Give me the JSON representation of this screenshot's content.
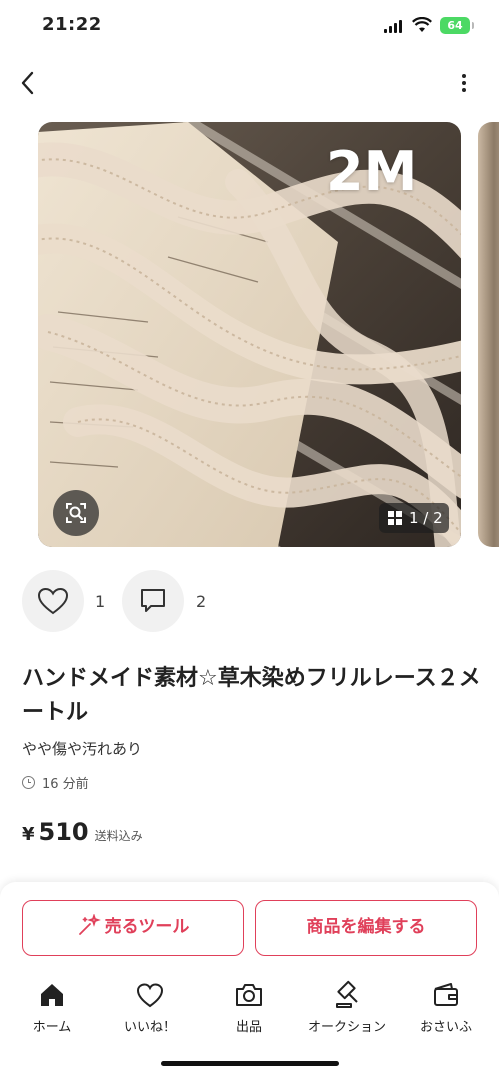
{
  "status_bar": {
    "time": "21:22",
    "battery": "64"
  },
  "listing": {
    "photo_overlay": "2M",
    "photo_counter": "1 / 2",
    "likes": "1",
    "comments": "2",
    "title": "ハンドメイド素材☆草木染めフリルレース２メートル",
    "condition": "やや傷や汚れあり",
    "posted": "16 分前",
    "price_symbol": "¥",
    "price": "510",
    "shipping": "送料込み"
  },
  "actions": {
    "sell_tool": "売るツール",
    "edit_item": "商品を編集する"
  },
  "tabs": [
    {
      "label": "ホーム",
      "icon": "home-icon"
    },
    {
      "label": "いいね！",
      "icon": "heart-icon"
    },
    {
      "label": "出品",
      "icon": "camera-icon"
    },
    {
      "label": "オークション",
      "icon": "gavel-icon"
    },
    {
      "label": "おさいふ",
      "icon": "wallet-icon"
    }
  ],
  "colors": {
    "accent": "#e0405a",
    "battery": "#4cd964"
  }
}
